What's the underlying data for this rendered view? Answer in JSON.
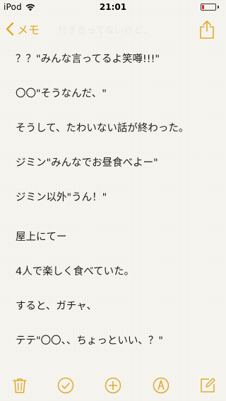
{
  "status": {
    "carrier": "iPod",
    "time": "21:01",
    "battery_percent": 15
  },
  "nav": {
    "back_label": "メモ",
    "ghost_title": "付き合ってないけど、",
    "share_icon": "share-icon"
  },
  "note": {
    "lines": [
      "？？\"みんな言ってるよ笑噂!!!\"",
      "〇〇\"そうなんだ、\"",
      "そうして、たわいない話が終わった。",
      "ジミン\"みんなでお昼食べよー\"",
      "ジミン以外\"うん！\"",
      "屋上にてー",
      "4人で楽しく食べていた。",
      "すると、ガチャ、",
      "テテ\"〇〇、、ちょっといい、？\""
    ]
  },
  "toolbar": {
    "icons": [
      "trash-icon",
      "checklist-icon",
      "add-icon",
      "markup-icon",
      "compose-icon"
    ]
  },
  "colors": {
    "accent": "#e0a92c",
    "battery_low": "#e2261f",
    "paper": "#f6f5f0"
  }
}
